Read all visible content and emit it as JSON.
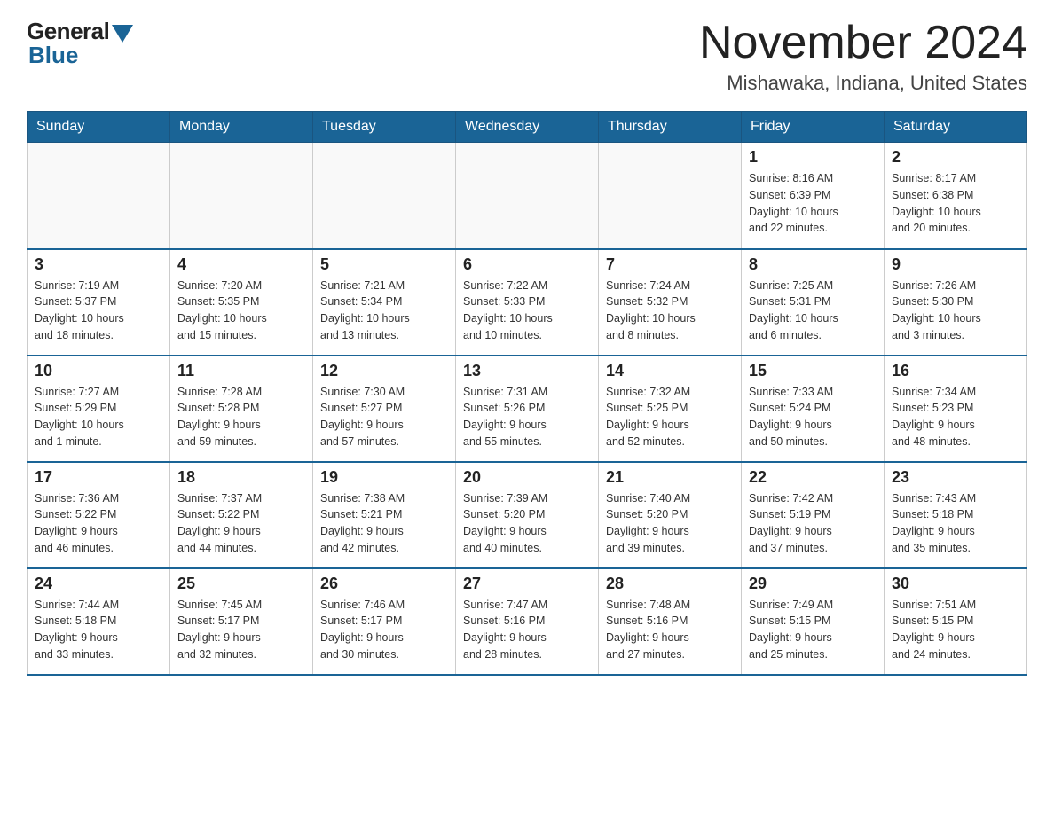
{
  "logo": {
    "general": "General",
    "blue": "Blue"
  },
  "header": {
    "month": "November 2024",
    "location": "Mishawaka, Indiana, United States"
  },
  "days_of_week": [
    "Sunday",
    "Monday",
    "Tuesday",
    "Wednesday",
    "Thursday",
    "Friday",
    "Saturday"
  ],
  "weeks": [
    [
      {
        "day": "",
        "info": ""
      },
      {
        "day": "",
        "info": ""
      },
      {
        "day": "",
        "info": ""
      },
      {
        "day": "",
        "info": ""
      },
      {
        "day": "",
        "info": ""
      },
      {
        "day": "1",
        "info": "Sunrise: 8:16 AM\nSunset: 6:39 PM\nDaylight: 10 hours\nand 22 minutes."
      },
      {
        "day": "2",
        "info": "Sunrise: 8:17 AM\nSunset: 6:38 PM\nDaylight: 10 hours\nand 20 minutes."
      }
    ],
    [
      {
        "day": "3",
        "info": "Sunrise: 7:19 AM\nSunset: 5:37 PM\nDaylight: 10 hours\nand 18 minutes."
      },
      {
        "day": "4",
        "info": "Sunrise: 7:20 AM\nSunset: 5:35 PM\nDaylight: 10 hours\nand 15 minutes."
      },
      {
        "day": "5",
        "info": "Sunrise: 7:21 AM\nSunset: 5:34 PM\nDaylight: 10 hours\nand 13 minutes."
      },
      {
        "day": "6",
        "info": "Sunrise: 7:22 AM\nSunset: 5:33 PM\nDaylight: 10 hours\nand 10 minutes."
      },
      {
        "day": "7",
        "info": "Sunrise: 7:24 AM\nSunset: 5:32 PM\nDaylight: 10 hours\nand 8 minutes."
      },
      {
        "day": "8",
        "info": "Sunrise: 7:25 AM\nSunset: 5:31 PM\nDaylight: 10 hours\nand 6 minutes."
      },
      {
        "day": "9",
        "info": "Sunrise: 7:26 AM\nSunset: 5:30 PM\nDaylight: 10 hours\nand 3 minutes."
      }
    ],
    [
      {
        "day": "10",
        "info": "Sunrise: 7:27 AM\nSunset: 5:29 PM\nDaylight: 10 hours\nand 1 minute."
      },
      {
        "day": "11",
        "info": "Sunrise: 7:28 AM\nSunset: 5:28 PM\nDaylight: 9 hours\nand 59 minutes."
      },
      {
        "day": "12",
        "info": "Sunrise: 7:30 AM\nSunset: 5:27 PM\nDaylight: 9 hours\nand 57 minutes."
      },
      {
        "day": "13",
        "info": "Sunrise: 7:31 AM\nSunset: 5:26 PM\nDaylight: 9 hours\nand 55 minutes."
      },
      {
        "day": "14",
        "info": "Sunrise: 7:32 AM\nSunset: 5:25 PM\nDaylight: 9 hours\nand 52 minutes."
      },
      {
        "day": "15",
        "info": "Sunrise: 7:33 AM\nSunset: 5:24 PM\nDaylight: 9 hours\nand 50 minutes."
      },
      {
        "day": "16",
        "info": "Sunrise: 7:34 AM\nSunset: 5:23 PM\nDaylight: 9 hours\nand 48 minutes."
      }
    ],
    [
      {
        "day": "17",
        "info": "Sunrise: 7:36 AM\nSunset: 5:22 PM\nDaylight: 9 hours\nand 46 minutes."
      },
      {
        "day": "18",
        "info": "Sunrise: 7:37 AM\nSunset: 5:22 PM\nDaylight: 9 hours\nand 44 minutes."
      },
      {
        "day": "19",
        "info": "Sunrise: 7:38 AM\nSunset: 5:21 PM\nDaylight: 9 hours\nand 42 minutes."
      },
      {
        "day": "20",
        "info": "Sunrise: 7:39 AM\nSunset: 5:20 PM\nDaylight: 9 hours\nand 40 minutes."
      },
      {
        "day": "21",
        "info": "Sunrise: 7:40 AM\nSunset: 5:20 PM\nDaylight: 9 hours\nand 39 minutes."
      },
      {
        "day": "22",
        "info": "Sunrise: 7:42 AM\nSunset: 5:19 PM\nDaylight: 9 hours\nand 37 minutes."
      },
      {
        "day": "23",
        "info": "Sunrise: 7:43 AM\nSunset: 5:18 PM\nDaylight: 9 hours\nand 35 minutes."
      }
    ],
    [
      {
        "day": "24",
        "info": "Sunrise: 7:44 AM\nSunset: 5:18 PM\nDaylight: 9 hours\nand 33 minutes."
      },
      {
        "day": "25",
        "info": "Sunrise: 7:45 AM\nSunset: 5:17 PM\nDaylight: 9 hours\nand 32 minutes."
      },
      {
        "day": "26",
        "info": "Sunrise: 7:46 AM\nSunset: 5:17 PM\nDaylight: 9 hours\nand 30 minutes."
      },
      {
        "day": "27",
        "info": "Sunrise: 7:47 AM\nSunset: 5:16 PM\nDaylight: 9 hours\nand 28 minutes."
      },
      {
        "day": "28",
        "info": "Sunrise: 7:48 AM\nSunset: 5:16 PM\nDaylight: 9 hours\nand 27 minutes."
      },
      {
        "day": "29",
        "info": "Sunrise: 7:49 AM\nSunset: 5:15 PM\nDaylight: 9 hours\nand 25 minutes."
      },
      {
        "day": "30",
        "info": "Sunrise: 7:51 AM\nSunset: 5:15 PM\nDaylight: 9 hours\nand 24 minutes."
      }
    ]
  ]
}
